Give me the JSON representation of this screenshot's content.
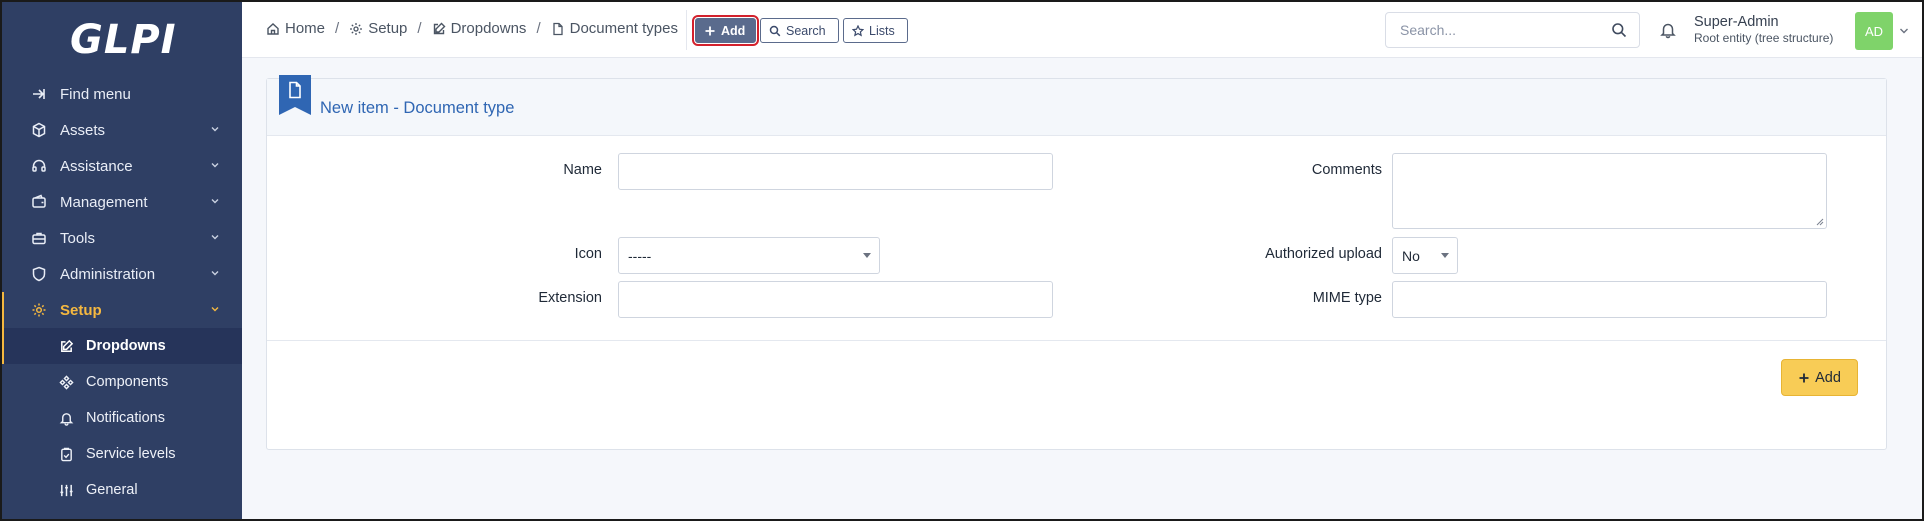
{
  "sidebar": {
    "logo": "GLPI",
    "items": [
      {
        "label": "Find menu",
        "icon": "arrow-right-icon"
      },
      {
        "label": "Assets",
        "icon": "cube-icon"
      },
      {
        "label": "Assistance",
        "icon": "headset-icon"
      },
      {
        "label": "Management",
        "icon": "wallet-icon"
      },
      {
        "label": "Tools",
        "icon": "briefcase-icon"
      },
      {
        "label": "Administration",
        "icon": "shield-icon"
      },
      {
        "label": "Setup",
        "icon": "gear-icon"
      }
    ],
    "setup_sub_items": [
      {
        "label": "Dropdowns",
        "icon": "edit-icon"
      },
      {
        "label": "Components",
        "icon": "components-icon"
      },
      {
        "label": "Notifications",
        "icon": "bell-icon"
      },
      {
        "label": "Service levels",
        "icon": "clipboard-check-icon"
      },
      {
        "label": "General",
        "icon": "sliders-icon"
      }
    ]
  },
  "topbar": {
    "breadcrumb": [
      "Home",
      "Setup",
      "Dropdowns",
      "Document types"
    ],
    "separator": "/",
    "add_label": "Add",
    "search_label": "Search",
    "lists_label": "Lists",
    "search_placeholder": "Search...",
    "user_name": "Super-Admin",
    "user_entity": "Root entity (tree structure)",
    "avatar_initials": "AD"
  },
  "form": {
    "title": "New item - Document type",
    "name_label": "Name",
    "name_value": "",
    "comments_label": "Comments",
    "comments_value": "",
    "icon_label": "Icon",
    "icon_value": "-----",
    "authorized_upload_label": "Authorized upload",
    "authorized_upload_value": "No",
    "extension_label": "Extension",
    "extension_value": "",
    "mime_label": "MIME type",
    "mime_value": "",
    "submit_label": "Add"
  },
  "colors": {
    "sidebar_bg": "#2f3f64",
    "accent_active": "#f5b840",
    "title_blue": "#2f66b3",
    "submit_yellow": "#f8cc56",
    "highlight_red": "#d3212c"
  }
}
